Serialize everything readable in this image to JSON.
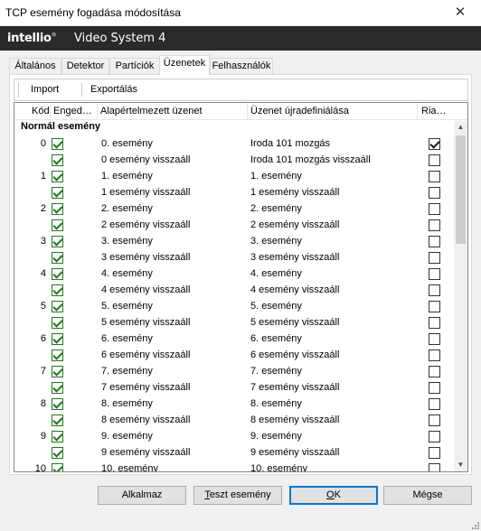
{
  "window": {
    "title": "TCP esemény fogadása módosítása",
    "close_glyph": "✕"
  },
  "banner": {
    "logo": "intellio",
    "reg_mark": "®",
    "product": "Video System 4"
  },
  "tabs": [
    {
      "label": "Általános"
    },
    {
      "label": "Detektor"
    },
    {
      "label": "Partíciók"
    },
    {
      "label": "Üzenetek"
    },
    {
      "label": "Felhasználók"
    }
  ],
  "active_tab": "Üzenetek",
  "toolbar": {
    "import_label": "Import",
    "export_label": "Exportálás"
  },
  "table": {
    "headers": {
      "kod": "Kód",
      "enged": "Enged…",
      "default_msg": "Alapértelmezett üzenet",
      "redef": "Üzenet újradefiniálása",
      "ria": "Ria…"
    },
    "group_label": "Normál esemény",
    "rows": [
      {
        "kod": "0",
        "enabled": true,
        "default_msg": "0. esemény",
        "redef": "Iroda 101 mozgás",
        "ria": true
      },
      {
        "kod": "",
        "enabled": true,
        "default_msg": "0 esemény visszaáll",
        "redef": "Iroda 101 mozgás visszaáll",
        "ria": false
      },
      {
        "kod": "1",
        "enabled": true,
        "default_msg": "1. esemény",
        "redef": "1. esemény",
        "ria": false
      },
      {
        "kod": "",
        "enabled": true,
        "default_msg": "1 esemény visszaáll",
        "redef": "1 esemény visszaáll",
        "ria": false
      },
      {
        "kod": "2",
        "enabled": true,
        "default_msg": "2. esemény",
        "redef": "2. esemény",
        "ria": false
      },
      {
        "kod": "",
        "enabled": true,
        "default_msg": "2 esemény visszaáll",
        "redef": "2 esemény visszaáll",
        "ria": false
      },
      {
        "kod": "3",
        "enabled": true,
        "default_msg": "3. esemény",
        "redef": "3. esemény",
        "ria": false
      },
      {
        "kod": "",
        "enabled": true,
        "default_msg": "3 esemény visszaáll",
        "redef": "3 esemény visszaáll",
        "ria": false
      },
      {
        "kod": "4",
        "enabled": true,
        "default_msg": "4. esemény",
        "redef": "4. esemény",
        "ria": false
      },
      {
        "kod": "",
        "enabled": true,
        "default_msg": "4 esemény visszaáll",
        "redef": "4 esemény visszaáll",
        "ria": false
      },
      {
        "kod": "5",
        "enabled": true,
        "default_msg": "5. esemény",
        "redef": "5. esemény",
        "ria": false
      },
      {
        "kod": "",
        "enabled": true,
        "default_msg": "5 esemény visszaáll",
        "redef": "5 esemény visszaáll",
        "ria": false
      },
      {
        "kod": "6",
        "enabled": true,
        "default_msg": "6. esemény",
        "redef": "6. esemény",
        "ria": false
      },
      {
        "kod": "",
        "enabled": true,
        "default_msg": "6 esemény visszaáll",
        "redef": "6 esemény visszaáll",
        "ria": false
      },
      {
        "kod": "7",
        "enabled": true,
        "default_msg": "7. esemény",
        "redef": "7. esemény",
        "ria": false
      },
      {
        "kod": "",
        "enabled": true,
        "default_msg": "7 esemény visszaáll",
        "redef": "7 esemény visszaáll",
        "ria": false
      },
      {
        "kod": "8",
        "enabled": true,
        "default_msg": "8. esemény",
        "redef": "8. esemény",
        "ria": false
      },
      {
        "kod": "",
        "enabled": true,
        "default_msg": "8 esemény visszaáll",
        "redef": "8 esemény visszaáll",
        "ria": false
      },
      {
        "kod": "9",
        "enabled": true,
        "default_msg": "9. esemény",
        "redef": "9. esemény",
        "ria": false
      },
      {
        "kod": "",
        "enabled": true,
        "default_msg": "9 esemény visszaáll",
        "redef": "9 esemény visszaáll",
        "ria": false
      },
      {
        "kod": "10",
        "enabled": true,
        "default_msg": "10. esemény",
        "redef": "10. esemény",
        "ria": false
      }
    ]
  },
  "buttons": {
    "apply": "Alkalmaz",
    "test_prefix": "T",
    "test_rest": "eszt esemény",
    "ok_prefix": "O",
    "ok_rest": "K",
    "cancel": "Mégse"
  },
  "colors": {
    "accent": "#0078d7",
    "banner_bg": "#2a2a2a",
    "checkbox_green": "#1e7a1e"
  },
  "icons": {
    "close": "close-icon",
    "scroll_up": "scroll-up-icon",
    "scroll_down": "scroll-down-icon",
    "enabled_checkbox": "checkbox-icon"
  }
}
